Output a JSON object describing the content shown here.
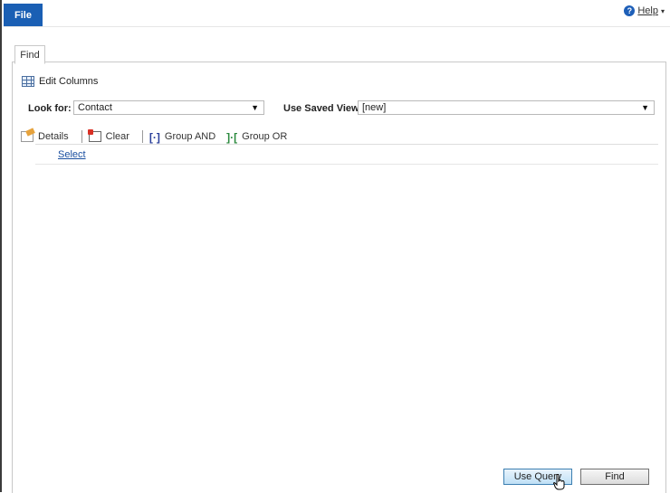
{
  "ribbon": {
    "file_label": "File",
    "help_label": "Help"
  },
  "tabs": {
    "find_tab": "Find"
  },
  "toolbar_top": {
    "edit_columns": "Edit Columns"
  },
  "look_for": {
    "label": "Look for:",
    "value": "Contact"
  },
  "saved_view": {
    "label": "Use Saved View:",
    "value": "[new]"
  },
  "query_toolbar": {
    "details": "Details",
    "clear": "Clear",
    "group_and": "Group AND",
    "group_or": "Group OR"
  },
  "query": {
    "select_link": "Select"
  },
  "buttons": {
    "use_query": "Use Query",
    "find": "Find"
  },
  "colors": {
    "file_tab_bg": "#1a5fb4",
    "link": "#1a4fa0"
  },
  "icons": {
    "help": "help-circle-icon",
    "edit_columns": "grid-icon",
    "details": "details-icon",
    "clear": "clear-icon",
    "group_and": "group-and-icon",
    "group_or": "group-or-icon",
    "cursor": "hand-pointer-icon"
  }
}
